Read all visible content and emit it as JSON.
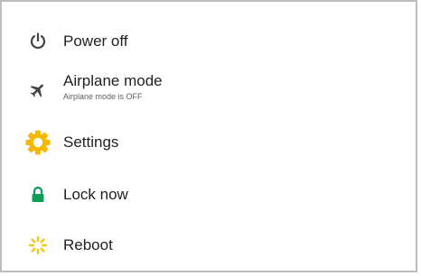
{
  "menu": {
    "items": [
      {
        "label": "Power off",
        "icon": "power-icon"
      },
      {
        "label": "Airplane mode",
        "sublabel": "Airplane mode is OFF",
        "icon": "airplane-icon"
      },
      {
        "label": "Settings",
        "icon": "settings-gear-icon"
      },
      {
        "label": "Lock now",
        "icon": "lock-icon"
      },
      {
        "label": "Reboot",
        "icon": "reboot-icon"
      }
    ]
  },
  "colors": {
    "text": "#212121",
    "subtext": "#616161",
    "icon_gray": "#424242",
    "settings_yellow": "#f9b800",
    "lock_green": "#0f9d58",
    "reboot_yellow": "#f5c518"
  }
}
